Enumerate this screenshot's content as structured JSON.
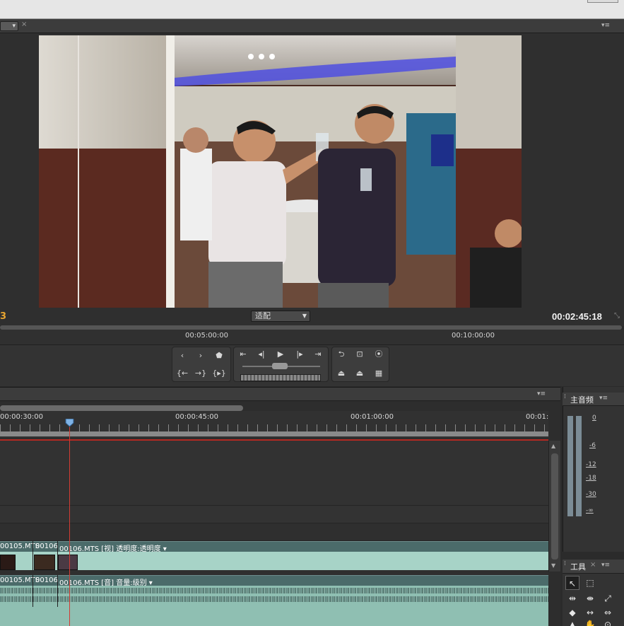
{
  "monitor": {
    "timecode_in": "3",
    "timecode_out": "00:02:45:18",
    "fit_label": "适配",
    "ruler_labels": [
      "00:05:00:00",
      "00:10:00:00"
    ]
  },
  "timeline": {
    "ruler_labels": [
      "00:00:30:00",
      "00:00:45:00",
      "00:01:00:00",
      "00:01:"
    ],
    "video_clips": [
      "00105.MTS",
      "00106",
      "00106.MTS  [视] 透明度:透明度 ▾"
    ],
    "audio_clips": [
      "00105.MTS",
      "00106",
      "00106.MTS  [音] 音量:级别 ▾"
    ]
  },
  "audio_meter": {
    "tab_label": "主音频",
    "scale_labels": [
      "0",
      "-6",
      "-12",
      "-18",
      "-30",
      "-∞"
    ]
  },
  "tools": {
    "tab_label": "工具"
  },
  "colors": {
    "accent_timecode": "#e8a530",
    "playhead": "#d23c34",
    "track_teal": "#a7d3c7"
  }
}
